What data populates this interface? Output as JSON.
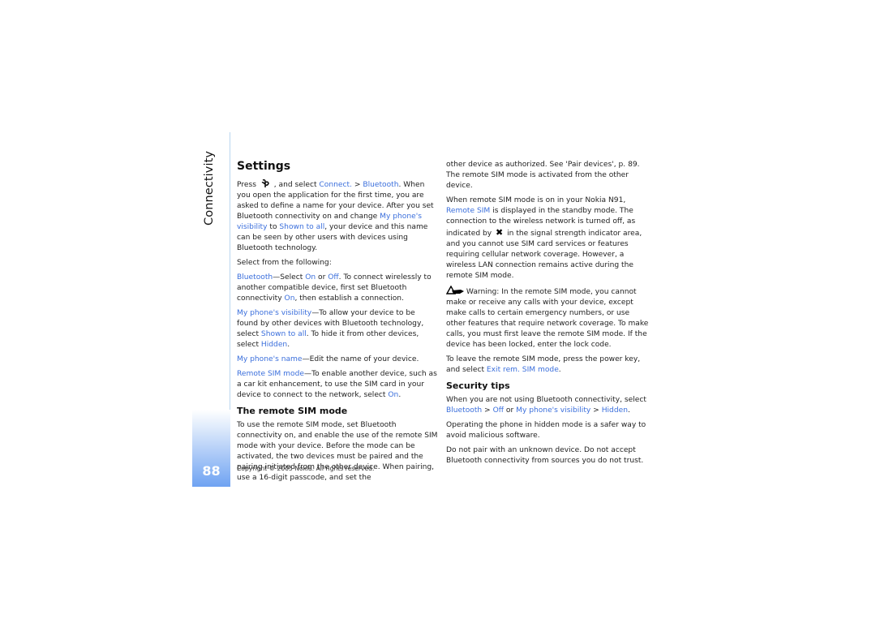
{
  "chapter": "Connectivity",
  "page_number": "88",
  "copyright": "Copyright © 2005 Nokia. All rights reserved.",
  "colors": {
    "link": "#3b6fdc",
    "rule": "#b9d6f0",
    "page_tab_bottom": "#6fa3f2"
  },
  "col1": {
    "heading": "Settings",
    "intro": {
      "t1": "Press ",
      "icon": "menu-key-icon",
      "t2": " , and select ",
      "l1": "Connect.",
      "t3": " > ",
      "l2": "Bluetooth",
      "t4": ". When you open the application for the first time, you are asked to define a name for your device. After you set Bluetooth connectivity on and change ",
      "l3": "My phone's visibility",
      "t5": " to ",
      "l4": "Shown to all",
      "t6": ", your device and this name can be seen by other users with devices using Bluetooth technology."
    },
    "select_from": "Select from the following:",
    "opt_bt": {
      "l1": "Bluetooth",
      "t1": "—Select ",
      "l2": "On",
      "t2": " or ",
      "l3": "Off",
      "t3": ". To connect wirelessly to another compatible device, first set Bluetooth connectivity ",
      "l4": "On",
      "t4": ", then establish a connection."
    },
    "opt_vis": {
      "l1": "My phone's visibility",
      "t1": "—To allow your device to be found by other devices with Bluetooth technology, select ",
      "l2": "Shown to all",
      "t2": ". To hide it from other devices, select ",
      "l3": "Hidden",
      "t3": "."
    },
    "opt_name": {
      "l1": "My phone's name",
      "t1": "—Edit the name of your device."
    },
    "opt_sim": {
      "l1": "Remote SIM mode",
      "t1": "—To enable another device, such as a car kit enhancement, to use the SIM card in your device to connect to the network, select ",
      "l2": "On",
      "t2": "."
    },
    "sub_heading": "The remote SIM mode",
    "remote_para": "To use the remote SIM mode, set Bluetooth connectivity on, and enable the use of the remote SIM mode with your device. Before the mode can be activated, the two devices must be paired and the pairing initiated from the other device. When pairing, use a 16-digit passcode, and set the"
  },
  "col2": {
    "cont_para": "other device as authorized. See 'Pair devices', p. 89. The remote SIM mode is activated from the other device.",
    "on_para": {
      "t1": "When remote SIM mode is on in your Nokia N91, ",
      "l1": "Remote SIM",
      "t2": " is displayed in the standby mode. The connection to the wireless network is turned off, as indicated by ",
      "icon": "no-network-x-icon",
      "t3": " in the signal strength indicator area, and you cannot use SIM card services or features requiring cellular network coverage. However, a wireless LAN connection remains active during the remote SIM mode."
    },
    "warning": "Warning: In the remote SIM mode, you cannot make or receive any calls with your device, except make calls to certain emergency numbers, or use other features that require network coverage. To make calls, you must first leave the remote SIM mode. If the device has been locked, enter the lock code.",
    "leave_para": {
      "t1": "To leave the remote SIM mode, press the power key, and select ",
      "l1": "Exit rem. SIM mode",
      "t2": "."
    },
    "security_heading": "Security tips",
    "sec1": {
      "t1": "When you are not using Bluetooth connectivity, select ",
      "l1": "Bluetooth",
      "t2": " > ",
      "l2": "Off",
      "t3": " or ",
      "l3": "My phone's visibility",
      "t4": " > ",
      "l4": "Hidden",
      "t5": "."
    },
    "sec2": "Operating the phone in hidden mode is a safer way to avoid malicious software.",
    "sec3": "Do not pair with an unknown device. Do not accept Bluetooth connectivity from sources you do not trust."
  }
}
